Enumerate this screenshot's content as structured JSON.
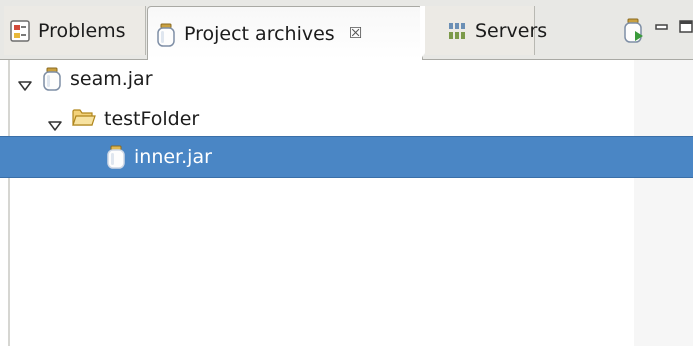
{
  "tabs": {
    "problems": {
      "label": "Problems",
      "icon": "problems-icon"
    },
    "project_archives": {
      "label": "Project archives",
      "icon": "jar-icon",
      "close": "☒"
    },
    "servers": {
      "label": "Servers",
      "icon": "servers-icon"
    }
  },
  "toolbar": {
    "new_archive_icon": "new-archive-icon",
    "minimize_icon": "minimize-icon",
    "maximize_icon": "maximize-icon"
  },
  "tree": {
    "nodes": [
      {
        "label": "seam.jar",
        "icon": "jar-icon",
        "expanded": true,
        "level": 0
      },
      {
        "label": "testFolder",
        "icon": "folder-icon",
        "expanded": true,
        "level": 1
      },
      {
        "label": "inner.jar",
        "icon": "jar-icon",
        "selected": true,
        "level": 2
      }
    ]
  },
  "colors": {
    "selection": "#4a86c5",
    "tabbar_background": "#e8e8e5",
    "folder": "#e8b84a"
  }
}
